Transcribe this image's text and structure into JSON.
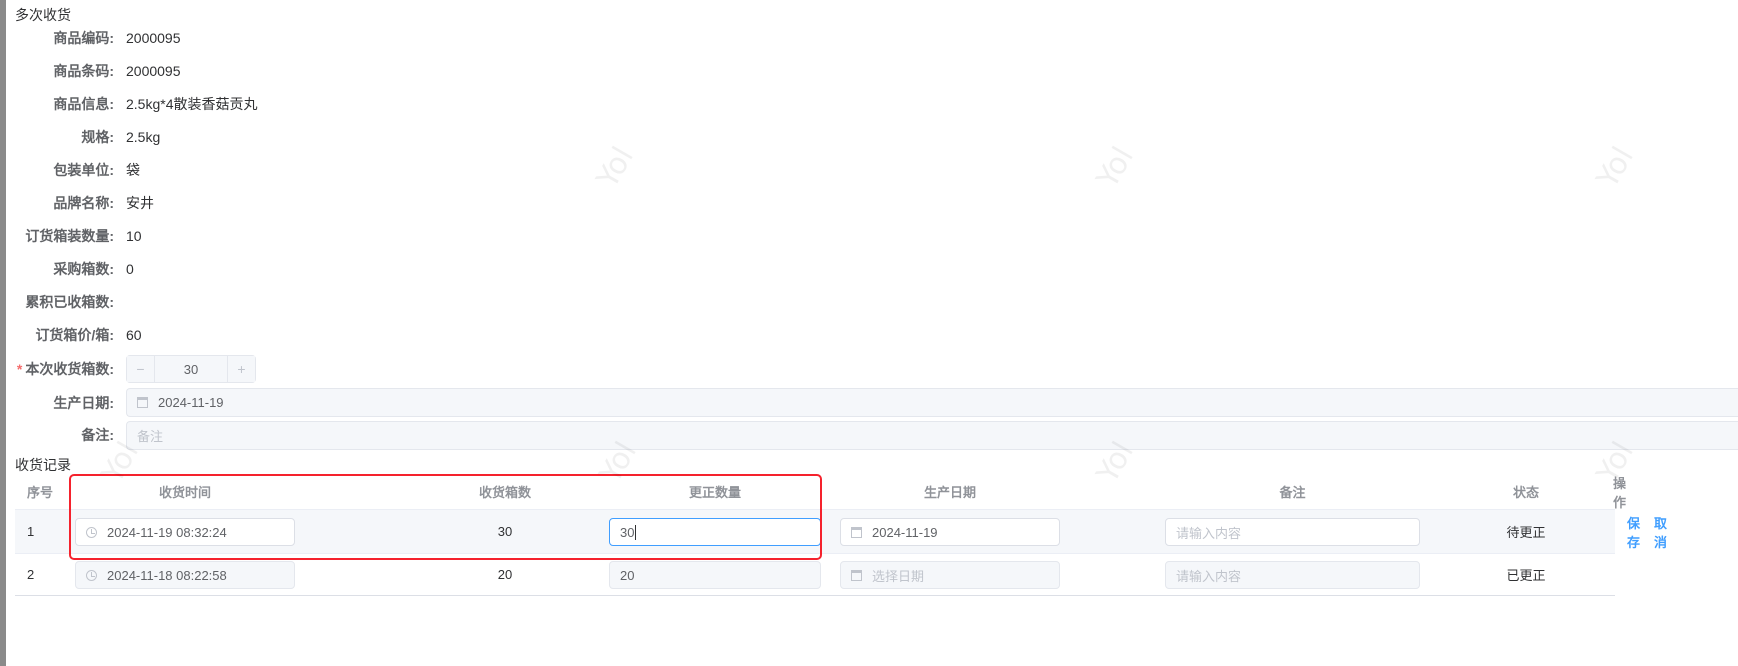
{
  "title": "多次收货",
  "fields": [
    {
      "label": "商品编码:",
      "value": "2000095"
    },
    {
      "label": "商品条码:",
      "value": "2000095"
    },
    {
      "label": "商品信息:",
      "value": "2.5kg*4散装香菇贡丸"
    },
    {
      "label": "规格:",
      "value": "2.5kg"
    },
    {
      "label": "包装单位:",
      "value": "袋"
    },
    {
      "label": "品牌名称:",
      "value": "安井"
    },
    {
      "label": "订货箱装数量:",
      "value": "10"
    },
    {
      "label": "采购箱数:",
      "value": "0"
    },
    {
      "label": "累积已收箱数:",
      "value": ""
    },
    {
      "label": "订货箱价/箱:",
      "value": "60"
    }
  ],
  "form": {
    "qty_label": "本次收货箱数:",
    "required_mark": "*",
    "qty_value": "30",
    "minus": "−",
    "plus": "+",
    "date_label": "生产日期:",
    "date_value": "2024-11-19",
    "remark_label": "备注:",
    "remark_placeholder": "备注"
  },
  "records": {
    "title": "收货记录",
    "headers": [
      "序号",
      "收货时间",
      "收货箱数",
      "更正数量",
      "生产日期",
      "备注",
      "状态",
      "操作"
    ],
    "rows": [
      {
        "index": "1",
        "time": "2024-11-19 08:32:24",
        "boxes": "30",
        "corrected": "30",
        "date": "2024-11-19",
        "remark_placeholder": "请输入内容",
        "status": "待更正",
        "save": "保存",
        "cancel": "取消"
      },
      {
        "index": "2",
        "time": "2024-11-18 08:22:58",
        "boxes": "20",
        "corrected": "20",
        "date_placeholder": "选择日期",
        "remark_placeholder": "请输入内容",
        "status": "已更正"
      }
    ]
  },
  "watermark": "Yol",
  "colors": {
    "accent": "#409eff",
    "highlight": "#f5222d",
    "required": "#f56c6c"
  }
}
